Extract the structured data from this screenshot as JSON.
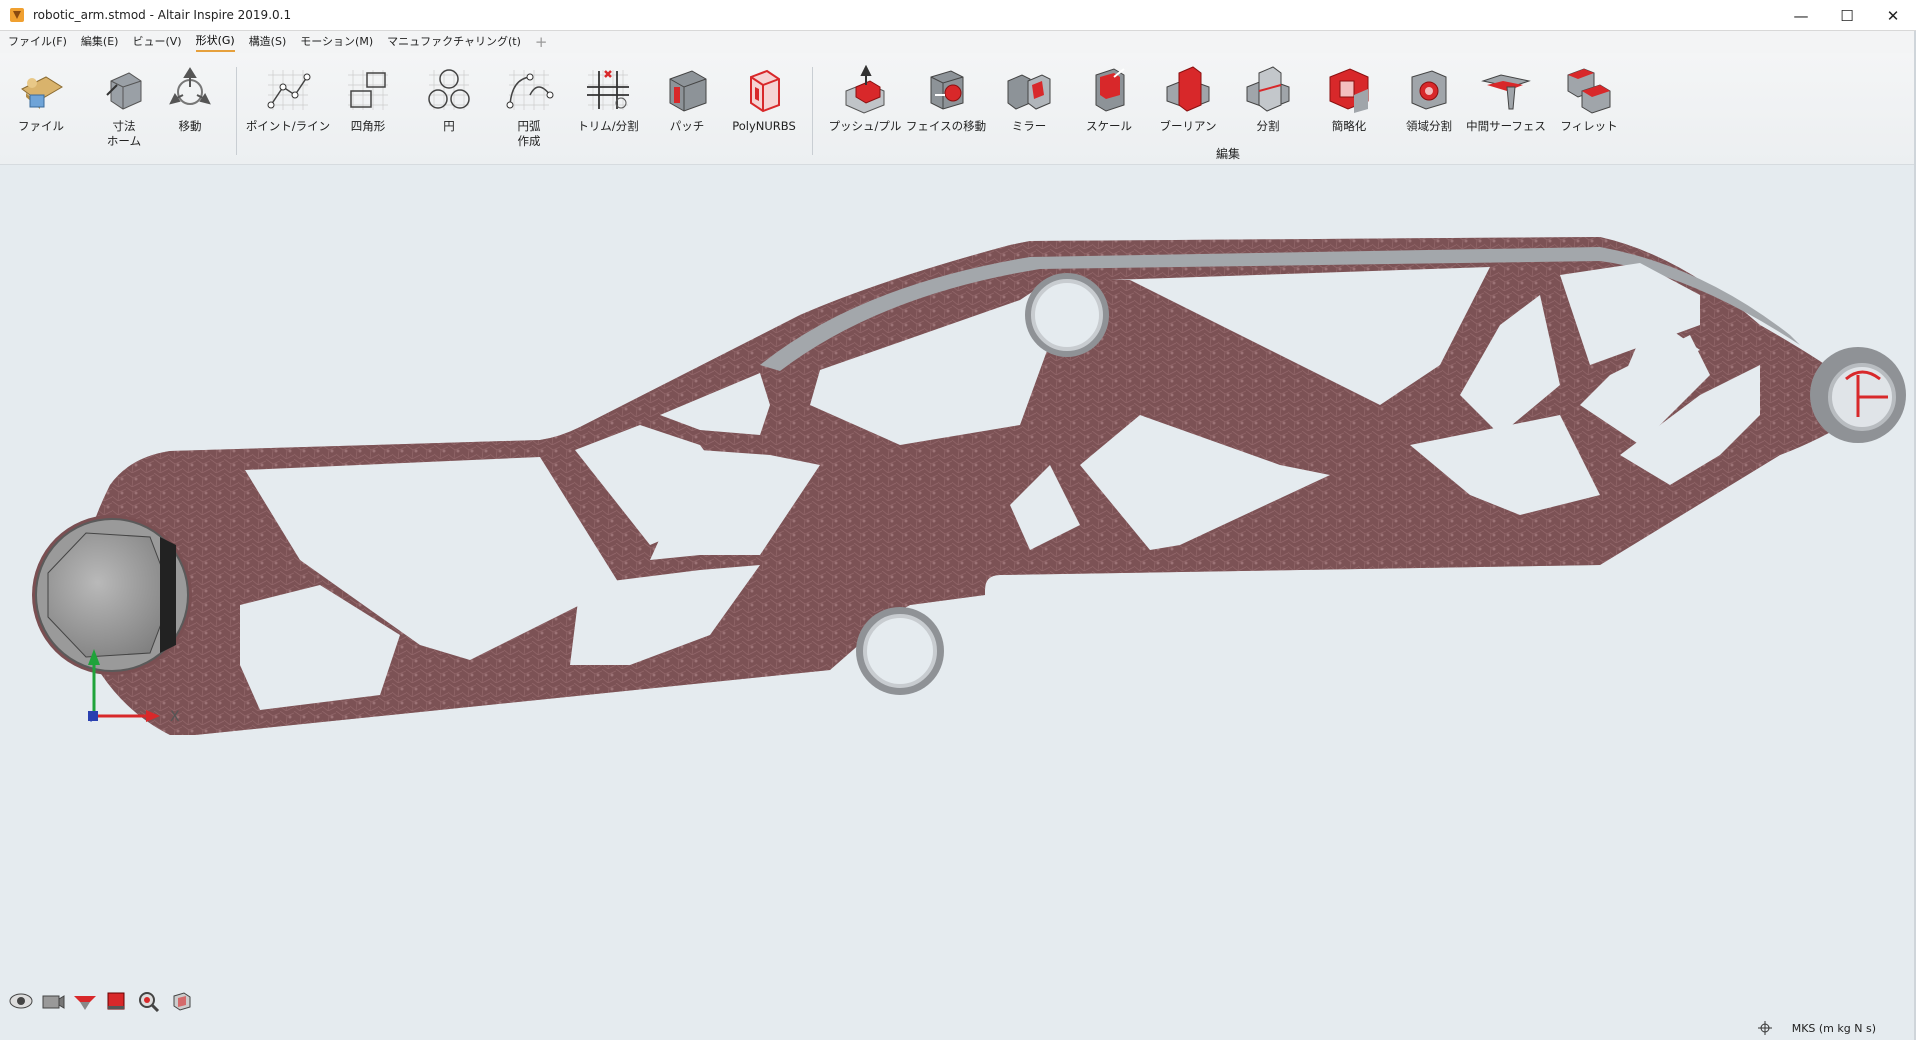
{
  "window": {
    "title": "robotic_arm.stmod - Altair Inspire 2019.0.1",
    "minimize": "—",
    "maximize": "☐",
    "close": "✕"
  },
  "menu": {
    "items": [
      "ファイル(F)",
      "編集(E)",
      "ビュー(V)",
      "形状(G)",
      "構造(S)",
      "モーション(M)",
      "マニュファクチャリング(t)"
    ],
    "active_index": 3,
    "plus": "+"
  },
  "ribbon": {
    "tools": [
      {
        "label": "ファイル",
        "icon": "file-icon"
      },
      {
        "label": "寸法\nホーム",
        "icon": "dimension-home-icon"
      },
      {
        "label": "移動",
        "icon": "move-icon"
      },
      {
        "label": "ポイント/ライン",
        "icon": "point-line-icon"
      },
      {
        "label": "四角形",
        "icon": "rectangle-icon"
      },
      {
        "label": "円",
        "icon": "circle-icon"
      },
      {
        "label": "円弧\n作成",
        "icon": "arc-icon"
      },
      {
        "label": "トリム/分割",
        "icon": "trim-split-icon"
      },
      {
        "label": "パッチ",
        "icon": "patch-icon"
      },
      {
        "label": "PolyNURBS",
        "icon": "polynurbs-icon"
      },
      {
        "label": "プッシュ/プル",
        "icon": "push-pull-icon"
      },
      {
        "label": "フェイスの移動",
        "icon": "move-face-icon"
      },
      {
        "label": "ミラー",
        "icon": "mirror-icon"
      },
      {
        "label": "スケール",
        "icon": "scale-icon"
      },
      {
        "label": "ブーリアン",
        "icon": "boolean-icon"
      },
      {
        "label": "分割",
        "icon": "split-icon"
      },
      {
        "label": "簡略化",
        "icon": "simplify-icon"
      },
      {
        "label": "領域分割",
        "icon": "partition-icon"
      },
      {
        "label": "中間サーフェス",
        "icon": "midsurface-icon"
      },
      {
        "label": "フィレット",
        "icon": "fillet-icon"
      }
    ],
    "group_edit_label": "編集"
  },
  "viewport": {
    "axis_x_label": "X",
    "model_color": "#7e5457",
    "accent_red": "#d8282a"
  },
  "status": {
    "units": "MKS (m kg N s)"
  }
}
